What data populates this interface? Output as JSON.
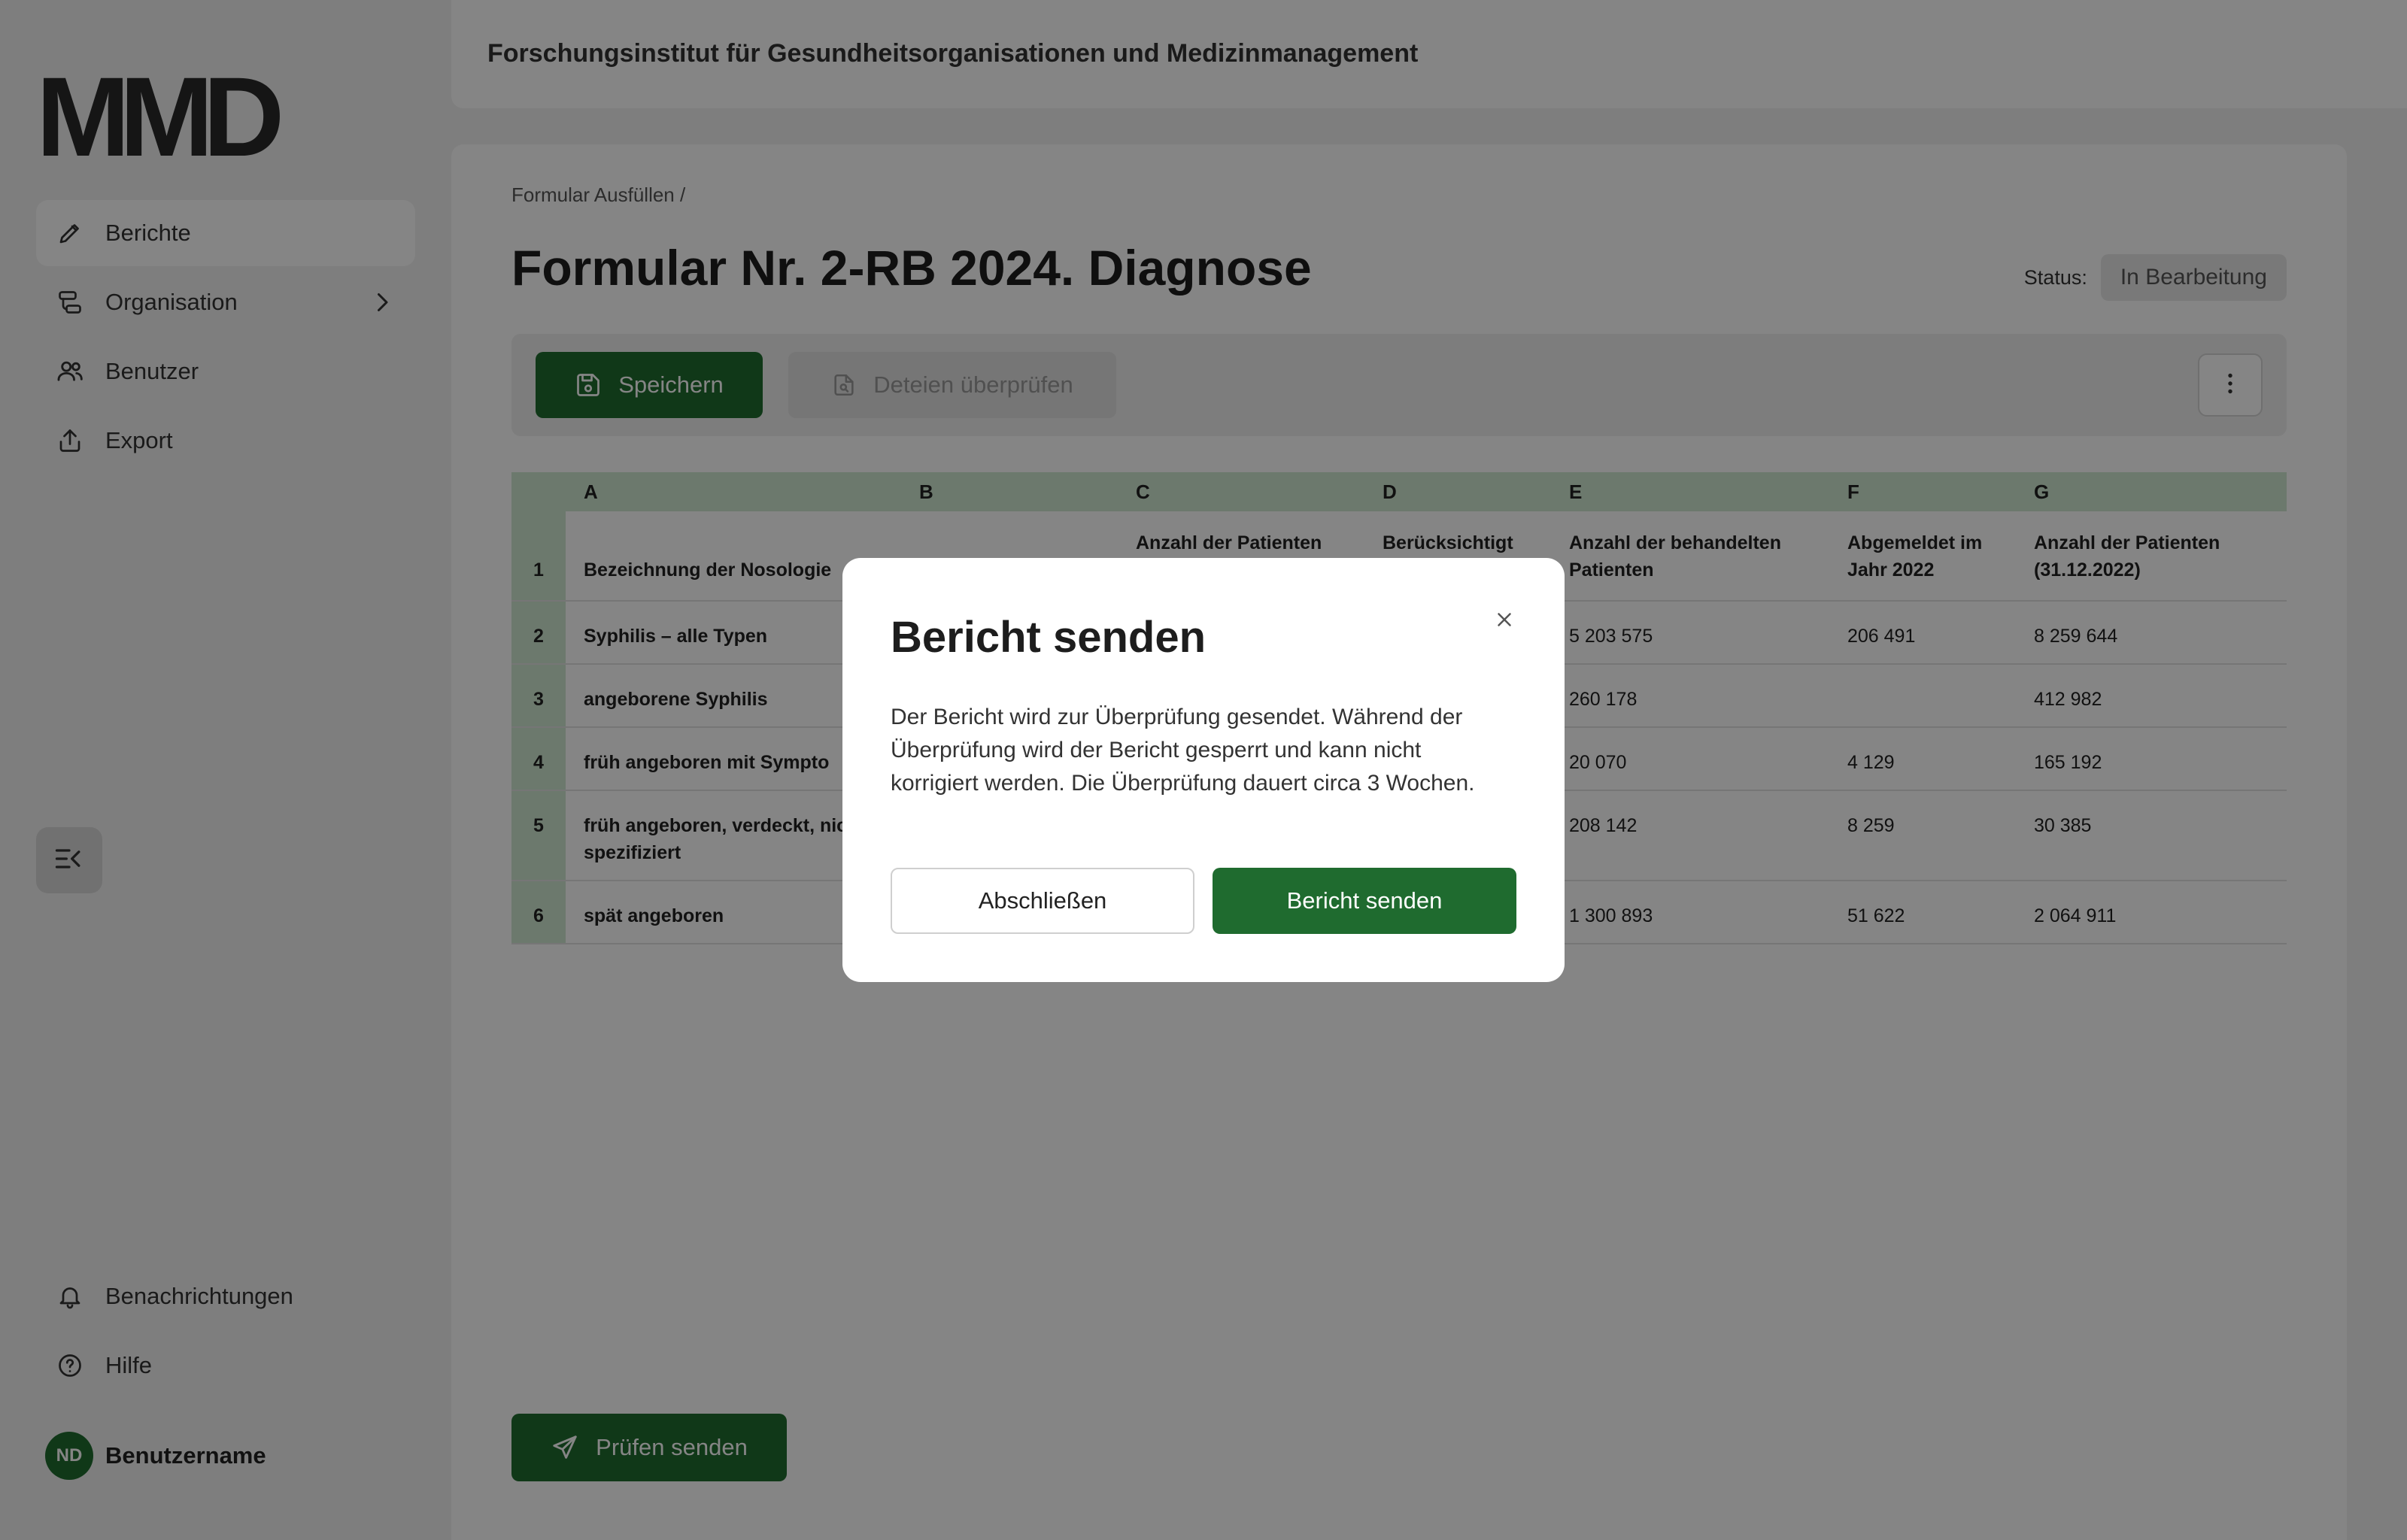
{
  "app": {
    "logo": "MMD",
    "header_title": "Forschungsinstitut für Gesundheitsorganisationen und Medizinmanagement"
  },
  "sidebar": {
    "items": [
      {
        "label": "Berichte",
        "icon": "pencil-icon",
        "active": true
      },
      {
        "label": "Organisation",
        "icon": "organisation-icon",
        "has_submenu": true
      },
      {
        "label": "Benutzer",
        "icon": "users-icon"
      },
      {
        "label": "Export",
        "icon": "upload-icon"
      }
    ],
    "bottom_items": [
      {
        "label": "Benachrichtungen",
        "icon": "bell-icon"
      },
      {
        "label": "Hilfe",
        "icon": "help-icon"
      }
    ],
    "user": {
      "initials": "ND",
      "name": "Benutzername"
    }
  },
  "page": {
    "breadcrumb": "Formular Ausfüllen  /",
    "title": "Formular Nr. 2-RB 2024. Diagnose",
    "status_label": "Status:",
    "status_value": "In Bearbeitung"
  },
  "toolbar": {
    "save_label": "Speichern",
    "check_label": "Deteien überprüfen"
  },
  "table": {
    "columns": [
      "A",
      "B",
      "C",
      "D",
      "E",
      "F",
      "G"
    ],
    "header_row": {
      "num": "1",
      "a": "Bezeichnung der Nosologie",
      "b": "",
      "c": "Anzahl der Patienten",
      "d": "Berücksichtigt",
      "e": "Anzahl der behandelten Patienten",
      "f": "Abgemeldet im Jahr 2022",
      "g": "Anzahl der Patienten (31.12.2022)"
    },
    "rows": [
      {
        "num": "2",
        "a": "Syphilis – alle Typen",
        "e": "5 203 575",
        "f": "206 491",
        "g": "8 259 644"
      },
      {
        "num": "3",
        "a": "angeborene Syphilis",
        "e": "260 178",
        "f": "",
        "g": "412 982"
      },
      {
        "num": "4",
        "a": "früh angeboren mit Sympto",
        "e": "20 070",
        "f": "4 129",
        "g": "165 192"
      },
      {
        "num": "5",
        "a": "früh angeboren, verdeckt, nicht spezifiziert",
        "e": "208 142",
        "f": "8 259",
        "g": "30 385"
      },
      {
        "num": "6",
        "a": "spät angeboren",
        "e": "1 300 893",
        "f": "51 622",
        "g": "2 064 911"
      }
    ]
  },
  "footer": {
    "send_review_label": "Prüfen senden"
  },
  "modal": {
    "title": "Bericht senden",
    "text": "Der Bericht wird zur Überprüfung gesendet. Während der Überprüfung wird der Bericht gesperrt und kann nicht korrigiert werden. Die Überprüfung dauert circa 3 Wochen.",
    "cancel_label": "Abschließen",
    "confirm_label": "Bericht senden"
  },
  "colors": {
    "accent": "#1f6b2f",
    "table_header": "#cfe9d1",
    "overlay": "rgba(0,0,0,0.48)"
  }
}
